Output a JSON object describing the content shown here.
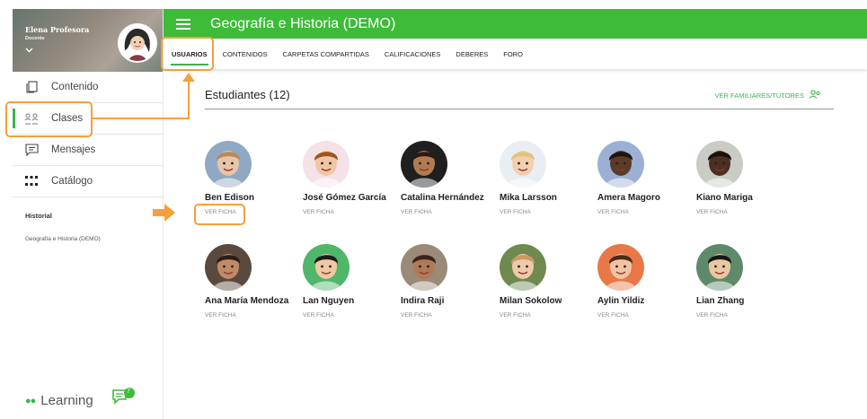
{
  "profile": {
    "name": "Elena Profesora",
    "role": "Docente"
  },
  "sidebar": {
    "items": [
      {
        "label": "Contenido",
        "icon": "copy-icon"
      },
      {
        "label": "Clases",
        "icon": "people-icon",
        "active": true
      },
      {
        "label": "Mensajes",
        "icon": "message-icon"
      },
      {
        "label": "Catálogo",
        "icon": "grid-icon"
      }
    ],
    "history_title": "Historial",
    "history_items": [
      "Geografía e Historia (DEMO)"
    ],
    "brand": "Learning",
    "chat_badge": "7"
  },
  "header": {
    "title": "Geografía e Historia (DEMO)"
  },
  "tabs": [
    {
      "label": "USUARIOS",
      "active": true
    },
    {
      "label": "CONTENIDOS"
    },
    {
      "label": "CARPETAS COMPARTIDAS"
    },
    {
      "label": "CALIFICACIONES"
    },
    {
      "label": "DEBERES"
    },
    {
      "label": "FORO"
    }
  ],
  "main": {
    "title": "Estudiantes (12)",
    "family_link": "VER FAMILIARES/TUTORES",
    "ficha_label": "VER FICHA",
    "students": [
      {
        "name": "Ben Edison",
        "bg": "#8fa9c4",
        "skin": "#e8c4a8",
        "hair": "#b98a55"
      },
      {
        "name": "José Gómez García",
        "bg": "#f4e2e6",
        "skin": "#f0c6a6",
        "hair": "#a0521e"
      },
      {
        "name": "Catalina Hernández",
        "bg": "#1f1f1f",
        "skin": "#b07a52",
        "hair": "#2b1a10"
      },
      {
        "name": "Mika Larsson",
        "bg": "#e9eef2",
        "skin": "#f2cfb1",
        "hair": "#e4c27a"
      },
      {
        "name": "Amera Magoro",
        "bg": "#9bb0d4",
        "skin": "#5a3a28",
        "hair": "#1d1410"
      },
      {
        "name": "Kiano Mariga",
        "bg": "#c8ccc4",
        "skin": "#4c2f22",
        "hair": "#1a120d"
      },
      {
        "name": "Ana María Mendoza",
        "bg": "#5a4a3e",
        "skin": "#c18a66",
        "hair": "#2e1d14"
      },
      {
        "name": "Lan Nguyen",
        "bg": "#4fb66a",
        "skin": "#f1c8a5",
        "hair": "#1c1c1c"
      },
      {
        "name": "Indira Raji",
        "bg": "#9a8a78",
        "skin": "#b07958",
        "hair": "#3a2418"
      },
      {
        "name": "Milan Sokolow",
        "bg": "#6f8a4e",
        "skin": "#eec9aa",
        "hair": "#c89a60"
      },
      {
        "name": "Aylin Yildiz",
        "bg": "#e87848",
        "skin": "#f0c4a2",
        "hair": "#4a2a18"
      },
      {
        "name": "Lian Zhang",
        "bg": "#5e8a6a",
        "skin": "#ebc7a2",
        "hair": "#161616"
      }
    ]
  },
  "colors": {
    "brand_green": "#3dbb39",
    "annotation_orange": "#f5a03a"
  }
}
